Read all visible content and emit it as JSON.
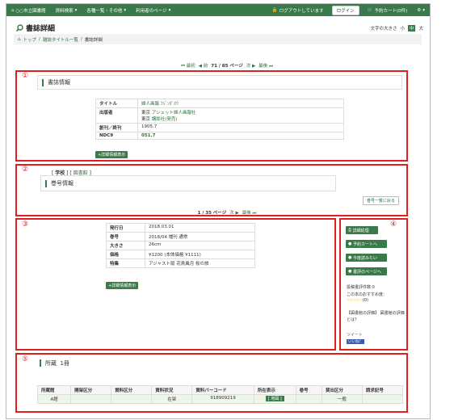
{
  "header": {
    "library": "○○市立図書館",
    "menu_search": "資料検索",
    "menu_lists": "各種一覧・その他",
    "menu_user": "利用者のページ",
    "login_status": "ログアウトしています",
    "login_button": "ログイン",
    "cart": "予約カート(0件)",
    "settings_icon": "gear-icon"
  },
  "page": {
    "title": "書誌詳細",
    "font_size_label": "文字の大きさ",
    "font_sizes": [
      "小",
      "中",
      "大"
    ]
  },
  "breadcrumb": [
    "トップ",
    "雑誌タイトル一覧",
    "書誌詳細"
  ],
  "pager_top": {
    "first": "最初",
    "prev": "前",
    "current": "71 / 85 ページ",
    "next": "次",
    "last": "最後"
  },
  "markers": [
    "①",
    "②",
    "③",
    "④",
    "⑤"
  ],
  "bib": {
    "heading": "書誌情報",
    "rows": [
      {
        "label": "タイトル",
        "value": "婦人画報",
        "kana": "ﾌｼﾞﾝｶﾞﾎｳ"
      },
      {
        "label": "出版者",
        "value1": "東京",
        "link1": "アシェット婦人画報社",
        "value2": "東京",
        "link2": "講談社(発売)"
      },
      {
        "label": "創刊／終刊",
        "value": "1905.7"
      },
      {
        "label": "NDC9",
        "value": "051.7"
      }
    ],
    "detail_button": "+詳細情報表示"
  },
  "volume": {
    "tag_school": "学校",
    "tag_library": "図書館",
    "heading": "巻号情報",
    "back_button": "巻号一覧に戻る",
    "pager": {
      "current": "1 / 35 ページ",
      "next": "次",
      "last": "最後"
    }
  },
  "issue": {
    "rows": [
      {
        "label": "発行日",
        "value": "2018.03.01"
      },
      {
        "label": "巻号",
        "value": "2018/04 増刊 通常"
      },
      {
        "label": "大きさ",
        "value": "26cm"
      },
      {
        "label": "価格",
        "value": "¥1200 (本体価格 ¥1111)"
      },
      {
        "label": "特集",
        "value": "アジャスト版 花鳥風月 桜の旅"
      }
    ],
    "detail_button": "+詳細情報表示"
  },
  "side": {
    "buttons": [
      "詳細処理",
      "予約カートへ",
      "今度読みたい",
      "書評のページへ"
    ],
    "review_count": "投稿書評件数:0",
    "recommend": "この本のおすすめ度：",
    "stars": "☆☆☆☆☆",
    "star_count": "(0)",
    "staff_review": "【図書館の評価】 図書館の評価とは？",
    "tweet": "ツイート",
    "like": "いいね！"
  },
  "holdings": {
    "heading": "所蔵",
    "count": "1冊",
    "columns": [
      "所蔵館",
      "開架区分",
      "資料区分",
      "資料状況",
      "資料バーコード",
      "所在表示",
      "巻号",
      "貸出区分",
      "請求記号"
    ],
    "rows": [
      {
        "library": "A館",
        "shelf": "",
        "type": "",
        "status": "在架",
        "barcode": "918909219",
        "location": "[ 地図 ]",
        "vol": "",
        "loan": "一般",
        "call": ""
      }
    ]
  }
}
